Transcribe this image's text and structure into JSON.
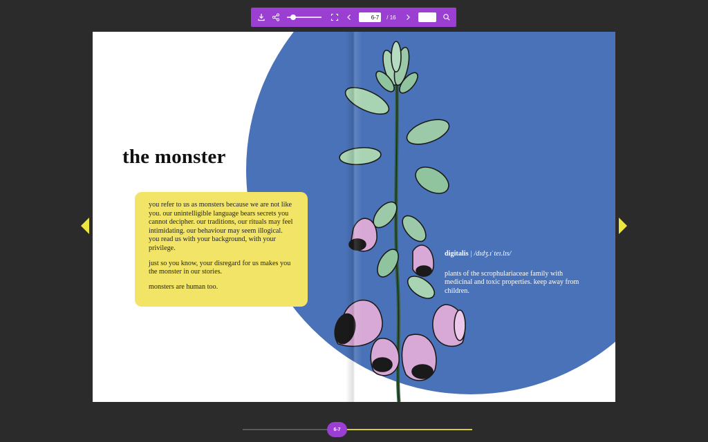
{
  "toolbar": {
    "page_value": "6-7",
    "page_total": "/ 16",
    "zoom_level": 0.1,
    "icons": [
      "download-icon",
      "share-icon",
      "fullscreen-icon",
      "chevron-left-icon",
      "chevron-right-icon",
      "search-icon"
    ],
    "accent_color": "#9a3fd2"
  },
  "left_page": {
    "title": "the monster",
    "box_color": "#f2e466",
    "paragraphs": [
      "you refer to us as monsters because we are not like you. our unintelligible language bears secrets you cannot decipher. our traditions, our rituals may feel intimidating. our behaviour may seem illogical. you read us with your background, with your privilege.",
      "just so you know, your disregard for us makes you the monster in our stories.",
      "monsters are human too."
    ]
  },
  "right_page": {
    "term": "digitalis",
    "pronunciation": "| /dɪdʒ.ɪˈteɪ.lɪs/",
    "definition": "plants of the scrophulariaceae family with medicinal and toxic properties. keep away from children.",
    "circle_color": "#4a72b8"
  },
  "navigation": {
    "progress": 0.41,
    "current_label": "6-7",
    "arrow_color": "#ece641"
  }
}
